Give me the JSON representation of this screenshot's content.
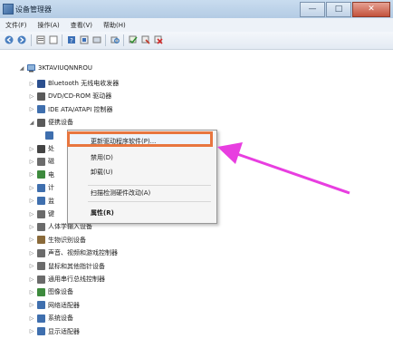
{
  "window": {
    "title": "设备管理器",
    "buttons": [
      "—",
      "□",
      "✕"
    ]
  },
  "menu": [
    "文件(F)",
    "操作(A)",
    "查看(V)",
    "帮助(H)"
  ],
  "toolbar_icons": [
    "back-icon",
    "forward-icon",
    "properties-icon",
    "help-icon",
    "update-driver-icon",
    "scan-hardware-icon",
    "disable-device-icon",
    "uninstall-device-icon"
  ],
  "tree": {
    "root": "3KTAVIUQNNROU",
    "items": [
      {
        "label": "Bluetooth 无线电收发器",
        "icon": "bluetooth-icon",
        "color": "#2b4f8e"
      },
      {
        "label": "DVD/CD-ROM 驱动器",
        "icon": "dvd-drive-icon",
        "color": "#5a5a5a"
      },
      {
        "label": "IDE ATA/ATAPI 控制器",
        "icon": "ide-controller-icon",
        "color": "#3f6fae"
      },
      {
        "label": "便携设备",
        "icon": "portable-device-icon",
        "color": "#5a5a5a",
        "expanded": true
      },
      {
        "label": "",
        "icon": "portable-device-icon",
        "color": "#3f6fae",
        "child": true
      },
      {
        "label": "处",
        "icon": "processor-icon",
        "color": "#444444"
      },
      {
        "label": "磁",
        "icon": "disk-drive-icon",
        "color": "#6b6b6b"
      },
      {
        "label": "电",
        "icon": "battery-icon",
        "color": "#3d8a3d"
      },
      {
        "label": "计",
        "icon": "computer-icon",
        "color": "#3f6fae"
      },
      {
        "label": "监",
        "icon": "monitor-icon",
        "color": "#3f6fae"
      },
      {
        "label": "键",
        "icon": "keyboard-icon",
        "color": "#6b6b6b"
      },
      {
        "label": "人体学输入设备",
        "icon": "hid-icon",
        "color": "#6b6b6b"
      },
      {
        "label": "生物识别设备",
        "icon": "biometric-icon",
        "color": "#8a6a3a"
      },
      {
        "label": "声音、视频和游戏控制器",
        "icon": "sound-icon",
        "color": "#6b6b6b"
      },
      {
        "label": "鼠标和其他指针设备",
        "icon": "mouse-icon",
        "color": "#6b6b6b"
      },
      {
        "label": "通用串行总线控制器",
        "icon": "usb-icon",
        "color": "#6b6b6b"
      },
      {
        "label": "图像设备",
        "icon": "camera-icon",
        "color": "#3d8a3d"
      },
      {
        "label": "网络适配器",
        "icon": "network-adapter-icon",
        "color": "#3f6fae"
      },
      {
        "label": "系统设备",
        "icon": "system-device-icon",
        "color": "#3f6fae"
      },
      {
        "label": "显示适配器",
        "icon": "display-adapter-icon",
        "color": "#3f6fae"
      }
    ]
  },
  "context_menu": {
    "update_driver": "更新驱动程序软件(P)...",
    "disable": "禁用(D)",
    "uninstall": "卸载(U)",
    "scan": "扫描检测硬件改动(A)",
    "properties": "属性(R)"
  },
  "accent_colors": {
    "highlight_border": "#e8763f",
    "arrow": "#e83ee0"
  }
}
